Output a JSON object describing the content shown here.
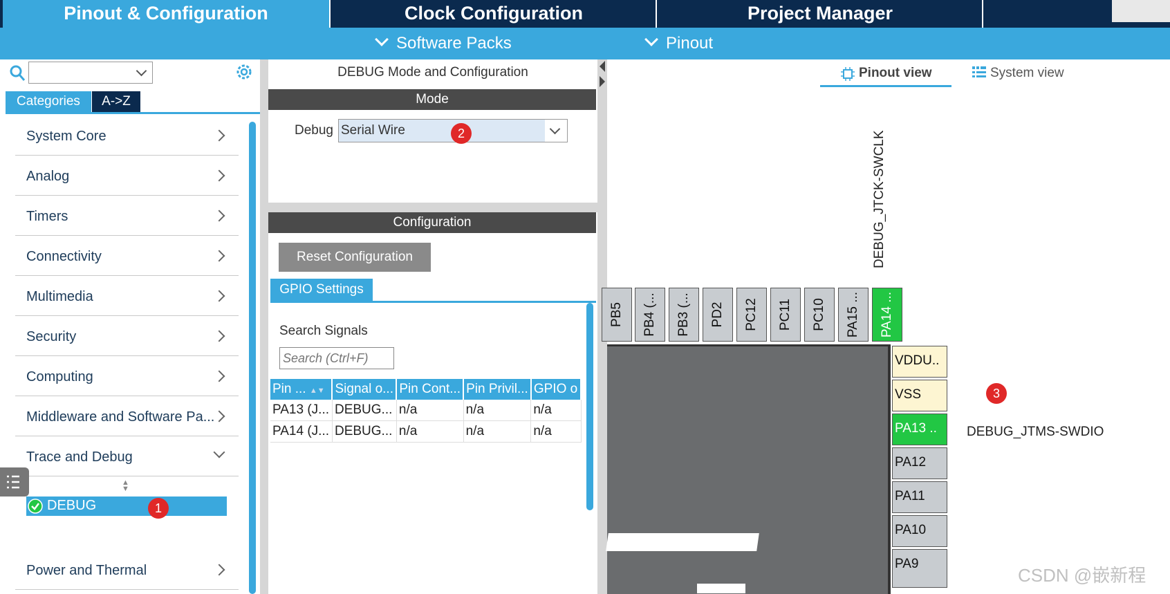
{
  "top_tabs": [
    "Pinout & Configuration",
    "Clock Configuration",
    "Project Manager"
  ],
  "sub_menu": [
    "Software Packs",
    "Pinout"
  ],
  "left": {
    "tabs": [
      "Categories",
      "A->Z"
    ],
    "categories": [
      "System Core",
      "Analog",
      "Timers",
      "Connectivity",
      "Multimedia",
      "Security",
      "Computing",
      "Middleware and Software Pa..."
    ],
    "expanded_category": "Trace and Debug",
    "selected_item": "DEBUG",
    "last_category": "Power and Thermal"
  },
  "middle": {
    "title": "DEBUG Mode and Configuration",
    "mode_header": "Mode",
    "debug_label": "Debug",
    "debug_value": "Serial Wire",
    "config_header": "Configuration",
    "reset_button": "Reset Configuration",
    "gpio_tab": "GPIO Settings",
    "search_label": "Search Signals",
    "search_placeholder": "Search (Ctrl+F)",
    "table": {
      "headers": [
        "Pin ...",
        "Signal o...",
        "Pin Cont...",
        "Pin Privil...",
        "GPIO o"
      ],
      "rows": [
        [
          "PA13 (J...",
          "DEBUG...",
          "n/a",
          "n/a",
          "n/a"
        ],
        [
          "PA14 (J...",
          "DEBUG...",
          "n/a",
          "n/a",
          "n/a"
        ]
      ]
    }
  },
  "right": {
    "view_tabs": [
      "Pinout view",
      "System view"
    ],
    "top_pins": [
      "PB5",
      "PB4 (...",
      "PB3 (...",
      "PD2",
      "PC12",
      "PC11",
      "PC10",
      "PA15 ...",
      "PA14 ..."
    ],
    "side_pins": [
      "VDDU..",
      "VSS",
      "PA13 ..",
      "PA12",
      "PA11",
      "PA10",
      "PA9"
    ],
    "signal_top": "DEBUG_JTCK-SWCLK",
    "signal_side": "DEBUG_JTMS-SWDIO"
  },
  "badges": [
    "1",
    "2",
    "3"
  ],
  "watermark": "CSDN @嵌新程",
  "colors": {
    "accent": "#3aa8dd",
    "dark": "#0b2a4e",
    "pin_green": "#22c744",
    "badge_red": "#e02828"
  }
}
